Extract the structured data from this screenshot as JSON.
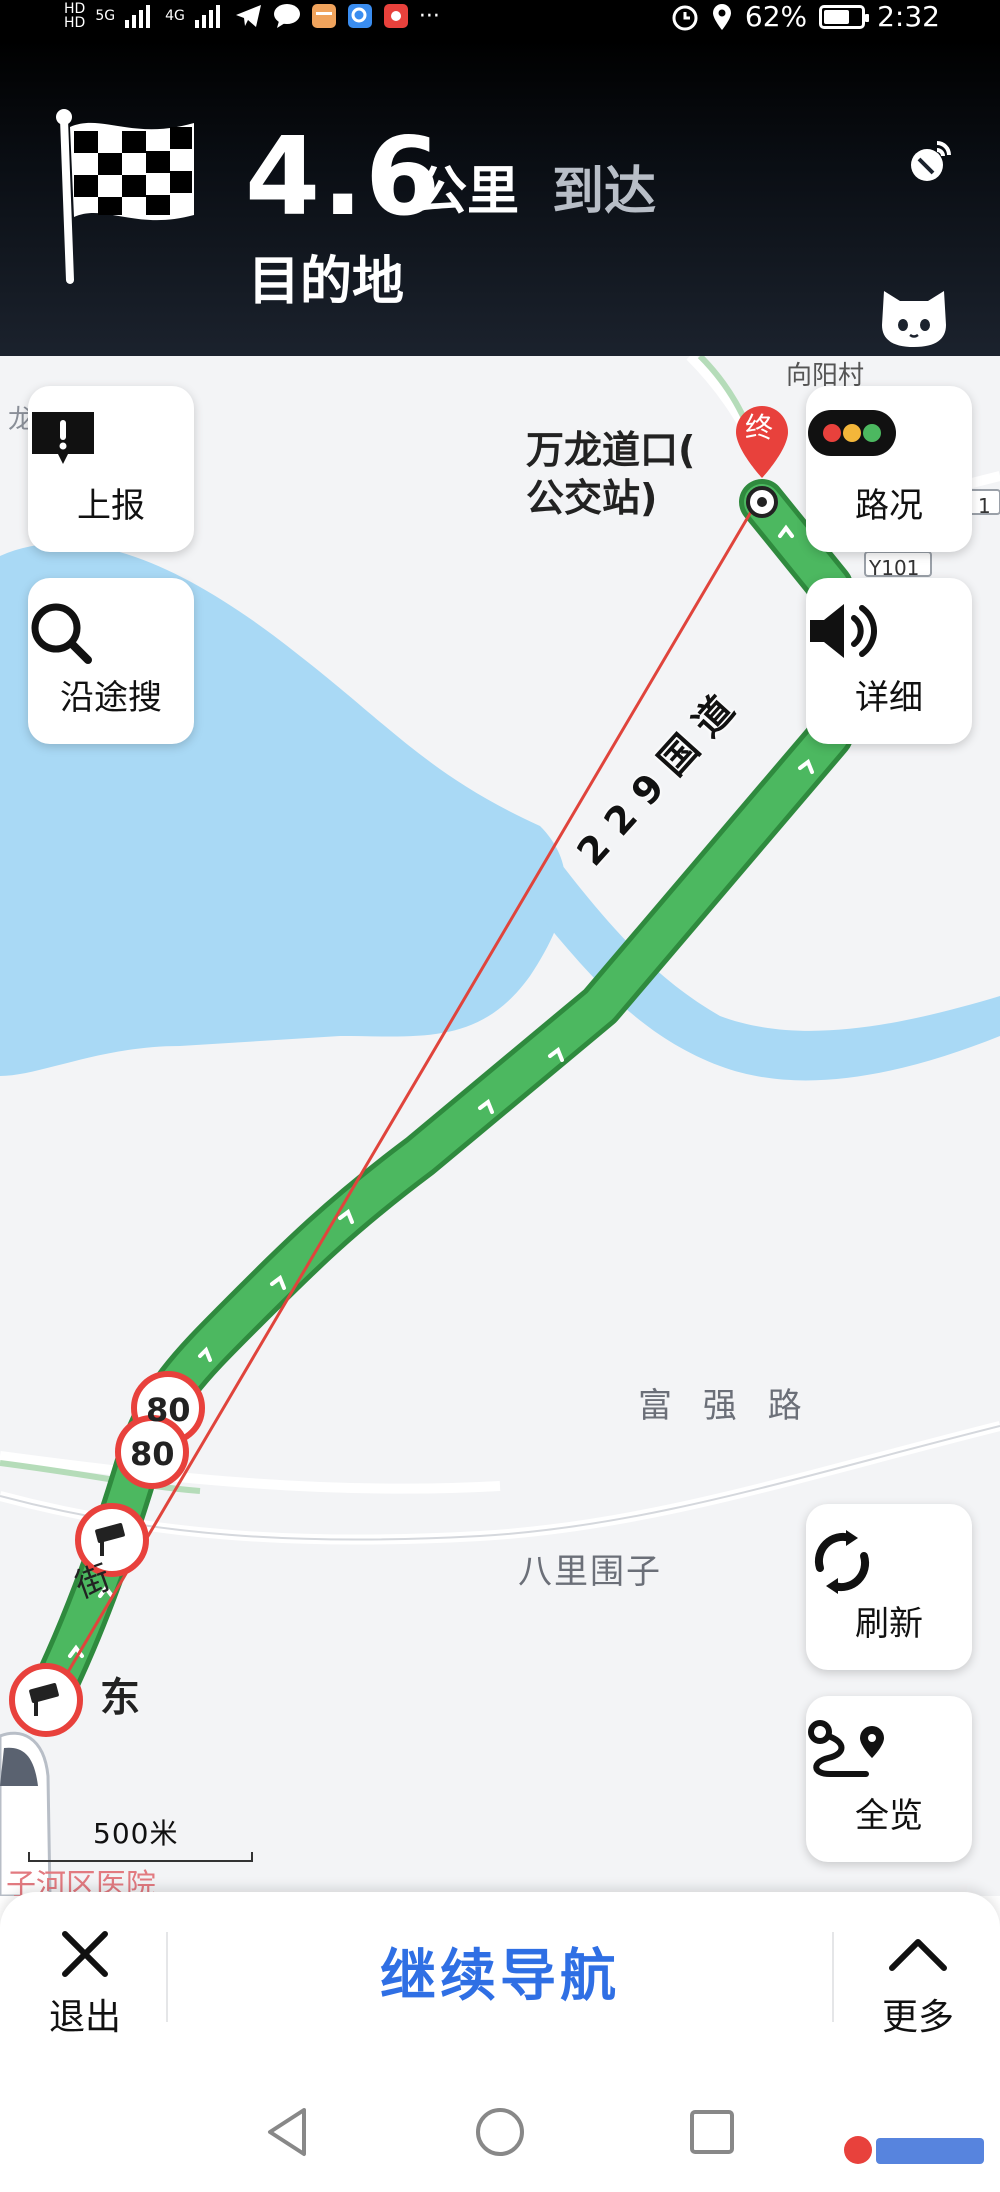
{
  "status_bar": {
    "hd1": "HD",
    "hd2": "HD",
    "net1": "5G",
    "net2": "4G",
    "battery_percent": "62%",
    "battery_level": 0.62,
    "time": "2:32",
    "more": "···"
  },
  "nav_header": {
    "distance_value": "4.6",
    "distance_unit": "公里",
    "arrive_text": "到达",
    "destination_text": "目的地"
  },
  "map": {
    "destination_marker": "终",
    "destination_name": "万龙道口(\n公交站)",
    "village_label": "向阳村",
    "road_badge_a": "Y101",
    "road_badge_b": "1",
    "route_road_name": "229国道",
    "road_label_right": "富 强 路",
    "area_label": "八里围子",
    "direction_label": "东",
    "street_char": "街",
    "hospital_label": "子河区医院",
    "edge_char": "龙",
    "speed_limit_1": "80",
    "speed_limit_2": "80",
    "scale_label": "500米"
  },
  "buttons": {
    "report": "上报",
    "along_search": "沿途搜",
    "traffic": "路况",
    "details": "详细",
    "refresh": "刷新",
    "overview": "全览"
  },
  "bottom_bar": {
    "exit": "退出",
    "continue": "继续导航",
    "more": "更多"
  },
  "colors": {
    "route_green": "#4cb860",
    "route_border": "#2f8a3e",
    "water_blue": "#a9d9f5",
    "accent_blue": "#2f6fe4",
    "marker_red": "#e8413c"
  }
}
